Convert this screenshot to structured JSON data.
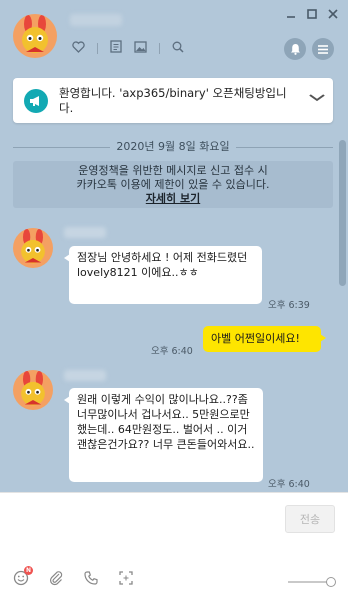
{
  "header": {
    "icons": [
      "heart-icon",
      "document-icon",
      "gallery-icon",
      "search-icon"
    ],
    "window_controls": [
      "minimize",
      "restore",
      "close"
    ],
    "right_buttons": [
      "bell-icon",
      "menu-icon"
    ]
  },
  "notice": {
    "text": "환영합니다. 'axp365/binary' 오픈채팅방입니다.",
    "icon": "megaphone-icon"
  },
  "date_divider": "2020년 9월 8일 화요일",
  "policy": {
    "line1": "운영정책을 위반한 메시지로 신고 접수 시",
    "line2": "카카오톡 이용에 제한이 있을 수 있습니다.",
    "link": "자세히 보기"
  },
  "messages": [
    {
      "side": "left",
      "text": "점장님 안녕하세요 ! 어제 전화드렸던 lovely8121 이에요..ㅎㅎ",
      "time": "오후 6:39"
    },
    {
      "side": "right",
      "text": "아벨 어쩐일이세요!",
      "time": "오후 6:40"
    },
    {
      "side": "left",
      "text": "원래 이렇게 수익이 많이나나요..??좀 너무많이나서 겁나서요.. 5만원으로만 했는데.. 64만원정도.. 벌어서 .. 이거 괜찮은건가요?? 너무 큰돈들어와서요..",
      "time": "오후 6:40"
    }
  ],
  "composer": {
    "send_label": "전송",
    "tools": [
      "emoticon-icon",
      "attach-icon",
      "call-icon",
      "capture-icon"
    ],
    "emoticon_badge": "N"
  },
  "colors": {
    "chat_bg": "#b2c7d9",
    "my_bubble": "#fee500",
    "notice_accent": "#12a9b3"
  }
}
